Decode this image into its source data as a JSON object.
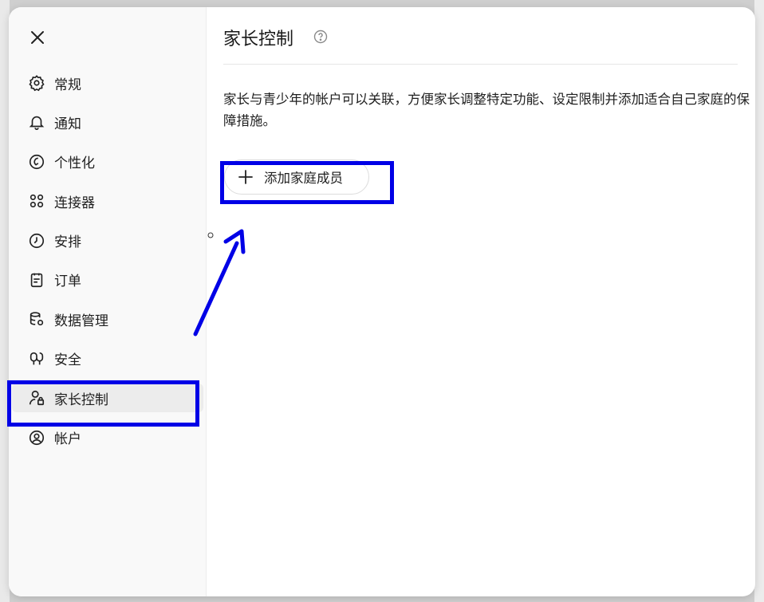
{
  "sidebar": {
    "items": [
      {
        "label": "常规",
        "icon": "gear-icon"
      },
      {
        "label": "通知",
        "icon": "bell-icon"
      },
      {
        "label": "个性化",
        "icon": "personalize-icon"
      },
      {
        "label": "连接器",
        "icon": "connectors-icon"
      },
      {
        "label": "安排",
        "icon": "clock-icon"
      },
      {
        "label": "订单",
        "icon": "orders-icon"
      },
      {
        "label": "数据管理",
        "icon": "database-gear-icon"
      },
      {
        "label": "安全",
        "icon": "security-icon"
      },
      {
        "label": "家长控制",
        "icon": "user-lock-icon",
        "active": true
      },
      {
        "label": "帐户",
        "icon": "account-circle-icon"
      }
    ]
  },
  "main": {
    "title": "家长控制",
    "description": "家长与青少年的帐户可以关联，方便家长调整特定功能、设定限制并添加适合自己家庭的保障措施。",
    "add_button_label": "添加家庭成员"
  },
  "colors": {
    "annotation": "#0000e6",
    "active_item_bg": "#ececec"
  }
}
